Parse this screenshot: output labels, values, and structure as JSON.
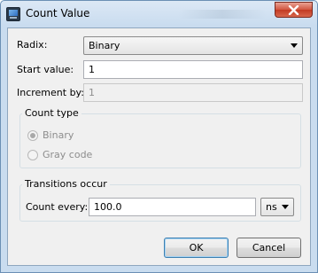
{
  "window": {
    "title": "Count Value",
    "close_icon": "close-icon"
  },
  "form": {
    "radix_label": "Radix:",
    "radix_value": "Binary",
    "start_label": "Start value:",
    "start_value": "1",
    "increment_label": "Increment by:",
    "increment_value": "1"
  },
  "count_type": {
    "title": "Count type",
    "options": [
      {
        "label": "Binary",
        "checked": true
      },
      {
        "label": "Gray code",
        "checked": false
      }
    ]
  },
  "transitions": {
    "title": "Transitions occur",
    "count_every_label": "Count every:",
    "count_every_value": "100.0",
    "unit_value": "ns"
  },
  "buttons": {
    "ok": "OK",
    "cancel": "Cancel"
  }
}
